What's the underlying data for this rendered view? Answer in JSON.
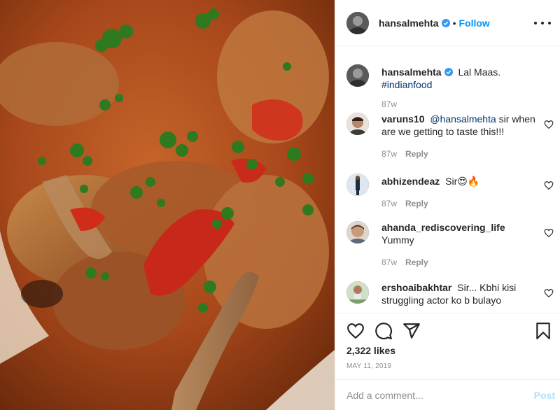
{
  "post": {
    "username": "hansalmehta",
    "follow_label": "Follow",
    "separator": "•",
    "caption": {
      "text": "Lal Maas.",
      "hashtag": "#indianfood",
      "age": "87w"
    }
  },
  "comments": [
    {
      "username": "varuns10",
      "mention": "@hansalmehta",
      "text": " sir when are we getting to taste this!!!",
      "age": "87w",
      "reply_label": "Reply"
    },
    {
      "username": "abhizendeaz",
      "text": "Sir😍🔥",
      "age": "87w",
      "reply_label": "Reply"
    },
    {
      "username": "ahanda_rediscovering_life",
      "text": "Yummy",
      "age": "87w",
      "reply_label": "Reply"
    },
    {
      "username": "ershoaibakhtar",
      "text": "Sir... Kbhi kisi struggling actor ko b bulayo",
      "age": "",
      "reply_label": ""
    }
  ],
  "stats": {
    "likes": "2,322 likes",
    "date": "MAY 11, 2019"
  },
  "composer": {
    "placeholder": "Add a comment...",
    "post_label": "Post"
  },
  "icons": {
    "like": "heart-outline-icon",
    "comment": "comment-bubble-icon",
    "share": "paper-plane-icon",
    "save": "bookmark-icon",
    "more": "more-options-icon",
    "verified": "verified-badge-icon"
  },
  "colors": {
    "link_blue": "#0095f6",
    "verified_blue": "#3897f0",
    "muted": "#8e8e8e",
    "post_disabled": "#b2dffc"
  }
}
